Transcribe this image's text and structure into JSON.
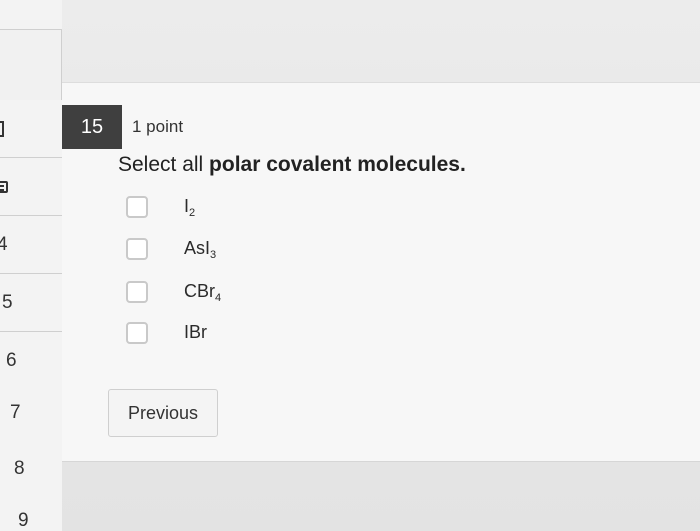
{
  "sidebar": {
    "items": [
      {
        "label": ""
      },
      {
        "label": ""
      },
      {
        "label": ""
      },
      {
        "label": "4"
      },
      {
        "label": "5"
      },
      {
        "label": "6"
      },
      {
        "label": "7"
      },
      {
        "label": "8"
      },
      {
        "label": "9"
      }
    ]
  },
  "question": {
    "number": "15",
    "points": "1 point",
    "prompt_prefix": "Select all ",
    "prompt_bold": "polar covalent molecules.",
    "options": [
      {
        "base": "I",
        "sub": "2",
        "suffix": "",
        "suffix_sub": ""
      },
      {
        "base": "AsI",
        "sub": "3",
        "suffix": "",
        "suffix_sub": ""
      },
      {
        "base": "CBr",
        "sub": "4",
        "suffix": "",
        "suffix_sub": ""
      },
      {
        "base": "IBr",
        "sub": "",
        "suffix": "",
        "suffix_sub": ""
      }
    ]
  },
  "navigation": {
    "previous_label": "Previous"
  },
  "icons": {
    "review-icon": "list-box",
    "flag-icon": "bracket"
  }
}
